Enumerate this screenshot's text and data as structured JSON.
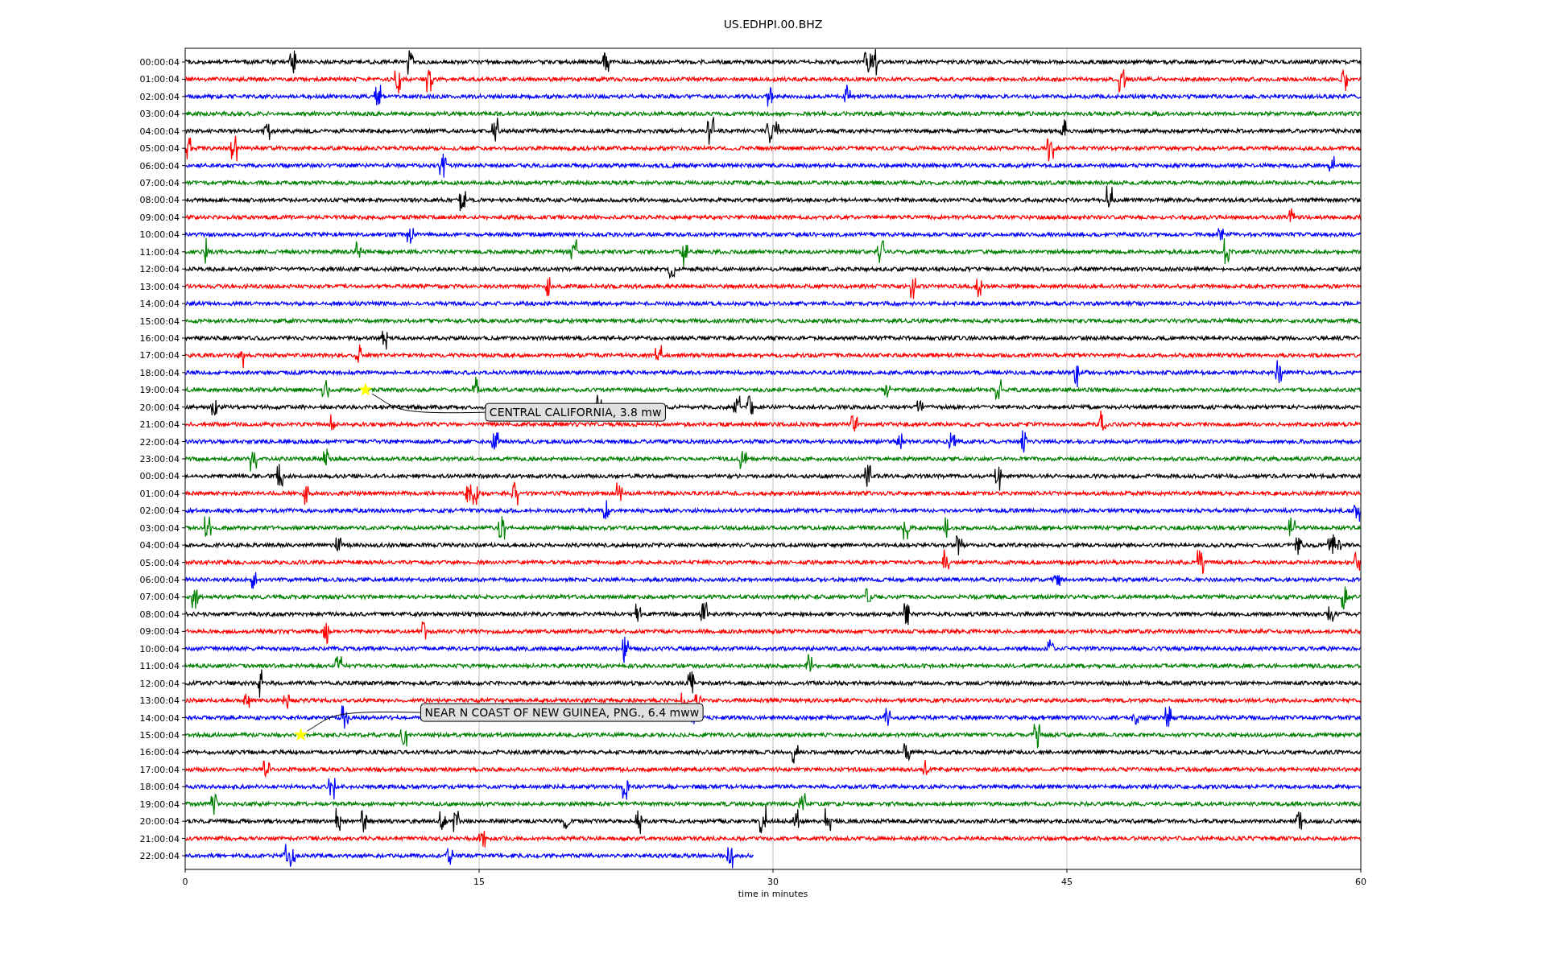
{
  "figure": {
    "title": "US.EDHPI.00.BHZ",
    "rows": [
      {
        "label": "00:00:04",
        "color": "#000000",
        "complete": true
      },
      {
        "label": "01:00:04",
        "color": "#ff0000",
        "complete": true
      },
      {
        "label": "02:00:04",
        "color": "#0000ff",
        "complete": true
      },
      {
        "label": "03:00:04",
        "color": "#008000",
        "complete": true
      },
      {
        "label": "04:00:04",
        "color": "#000000",
        "complete": true
      },
      {
        "label": "05:00:04",
        "color": "#ff0000",
        "complete": true
      },
      {
        "label": "06:00:04",
        "color": "#0000ff",
        "complete": true
      },
      {
        "label": "07:00:04",
        "color": "#008000",
        "complete": true
      },
      {
        "label": "08:00:04",
        "color": "#000000",
        "complete": true
      },
      {
        "label": "09:00:04",
        "color": "#ff0000",
        "complete": true
      },
      {
        "label": "10:00:04",
        "color": "#0000ff",
        "complete": true
      },
      {
        "label": "11:00:04",
        "color": "#008000",
        "complete": true
      },
      {
        "label": "12:00:04",
        "color": "#000000",
        "complete": true
      },
      {
        "label": "13:00:04",
        "color": "#ff0000",
        "complete": true
      },
      {
        "label": "14:00:04",
        "color": "#0000ff",
        "complete": true
      },
      {
        "label": "15:00:04",
        "color": "#008000",
        "complete": true
      },
      {
        "label": "16:00:04",
        "color": "#000000",
        "complete": true
      },
      {
        "label": "17:00:04",
        "color": "#ff0000",
        "complete": true
      },
      {
        "label": "18:00:04",
        "color": "#0000ff",
        "complete": true
      },
      {
        "label": "19:00:04",
        "color": "#008000",
        "complete": true,
        "event": "CENTRAL CALIFORNIA, 3.8 mw"
      },
      {
        "label": "20:00:04",
        "color": "#000000",
        "complete": true
      },
      {
        "label": "21:00:04",
        "color": "#ff0000",
        "complete": true
      },
      {
        "label": "22:00:04",
        "color": "#0000ff",
        "complete": true
      },
      {
        "label": "23:00:04",
        "color": "#008000",
        "complete": true
      },
      {
        "label": "00:00:04",
        "color": "#000000",
        "complete": true
      },
      {
        "label": "01:00:04",
        "color": "#ff0000",
        "complete": true
      },
      {
        "label": "02:00:04",
        "color": "#0000ff",
        "complete": true
      },
      {
        "label": "03:00:04",
        "color": "#008000",
        "complete": true
      },
      {
        "label": "04:00:04",
        "color": "#000000",
        "complete": true
      },
      {
        "label": "05:00:04",
        "color": "#ff0000",
        "complete": true
      },
      {
        "label": "06:00:04",
        "color": "#0000ff",
        "complete": true
      },
      {
        "label": "07:00:04",
        "color": "#008000",
        "complete": true
      },
      {
        "label": "08:00:04",
        "color": "#000000",
        "complete": true
      },
      {
        "label": "09:00:04",
        "color": "#ff0000",
        "complete": true
      },
      {
        "label": "10:00:04",
        "color": "#0000ff",
        "complete": true
      },
      {
        "label": "11:00:04",
        "color": "#008000",
        "complete": true
      },
      {
        "label": "12:00:04",
        "color": "#000000",
        "complete": true
      },
      {
        "label": "13:00:04",
        "color": "#ff0000",
        "complete": true
      },
      {
        "label": "14:00:04",
        "color": "#0000ff",
        "complete": true
      },
      {
        "label": "15:00:04",
        "color": "#008000",
        "complete": true,
        "event": "NEAR N COAST OF NEW GUINEA, PNG., 6.4 mww"
      },
      {
        "label": "16:00:04",
        "color": "#000000",
        "complete": true
      },
      {
        "label": "17:00:04",
        "color": "#ff0000",
        "complete": true
      },
      {
        "label": "18:00:04",
        "color": "#0000ff",
        "complete": true
      },
      {
        "label": "19:00:04",
        "color": "#008000",
        "complete": true
      },
      {
        "label": "20:00:04",
        "color": "#000000",
        "complete": true
      },
      {
        "label": "21:00:04",
        "color": "#ff0000",
        "complete": true
      },
      {
        "label": "22:00:04",
        "color": "#0000ff",
        "complete": false
      }
    ],
    "x_tick_labels": [
      "0",
      "15",
      "30",
      "45",
      "60"
    ],
    "x_axis_label": "time in minutes"
  }
}
